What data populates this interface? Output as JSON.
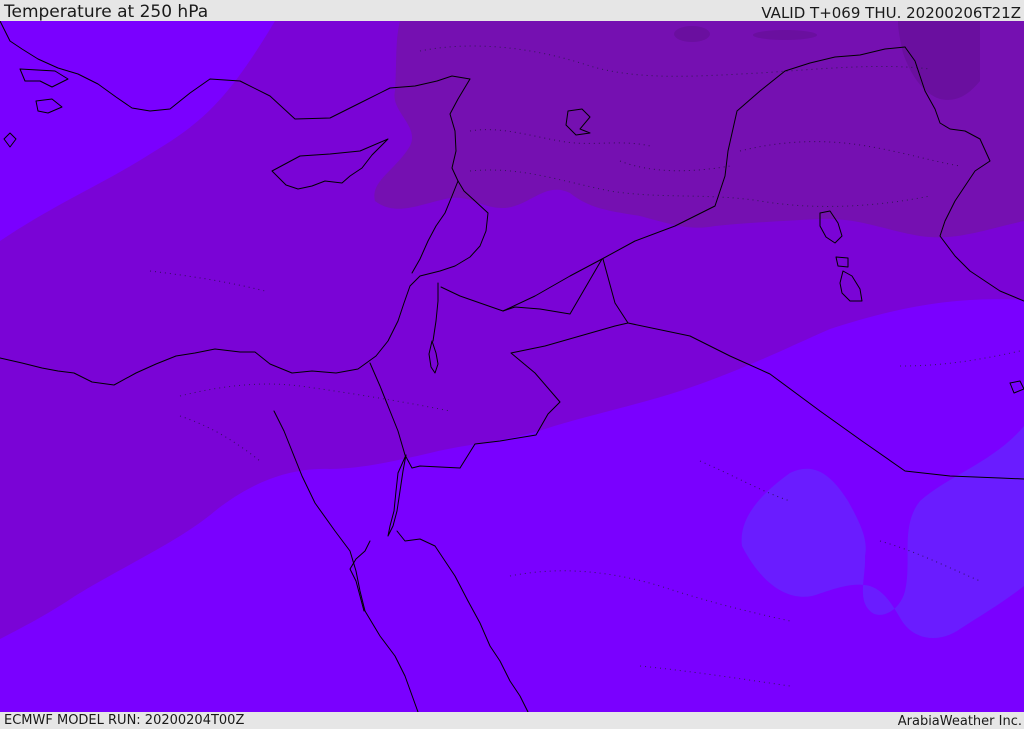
{
  "header": {
    "title": "Temperature at 250 hPa",
    "valid": "VALID T+069 THU. 20200206T21Z"
  },
  "footer": {
    "model_run": "ECMWF MODEL RUN: 20200204T00Z",
    "credit": "ArabiaWeather Inc."
  },
  "map": {
    "field": "Temperature at 250 hPa",
    "palette": {
      "coldest": "#6a0f9f",
      "very_cold": "#7510b1",
      "cold": "#7a04d6",
      "mild": "#7a00ff",
      "warmest": "#6a1cff"
    },
    "boundary_color": "#000000"
  }
}
